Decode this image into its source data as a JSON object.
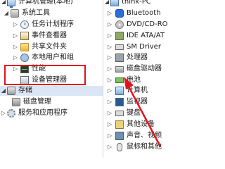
{
  "left_tree": {
    "root_label": "计算机管理(本地)",
    "system_tools": "系统工具",
    "task_scheduler": "任务计划程序",
    "event_viewer": "事件查看器",
    "shared_folders": "共享文件夹",
    "local_users_groups": "本地用户和组",
    "performance": "性能",
    "device_manager": "设备管理器",
    "storage": "存储",
    "disk_management": "磁盘管理",
    "services_apps": "服务和应用程序"
  },
  "right_tree": {
    "root_label": "think-PC",
    "items": [
      "Bluetooth",
      "DVD/CD-RO",
      "IDE ATA/AT",
      "SM Driver",
      "处理器",
      "磁盘驱动器",
      "电池",
      "计算机",
      "监视器",
      "键盘",
      "其他设备",
      "声音、视频",
      "鼠标和其他"
    ]
  },
  "colors": {
    "highlight": "#e0141c",
    "arrow": "#e0141c",
    "selection": "#dbe6f4"
  }
}
